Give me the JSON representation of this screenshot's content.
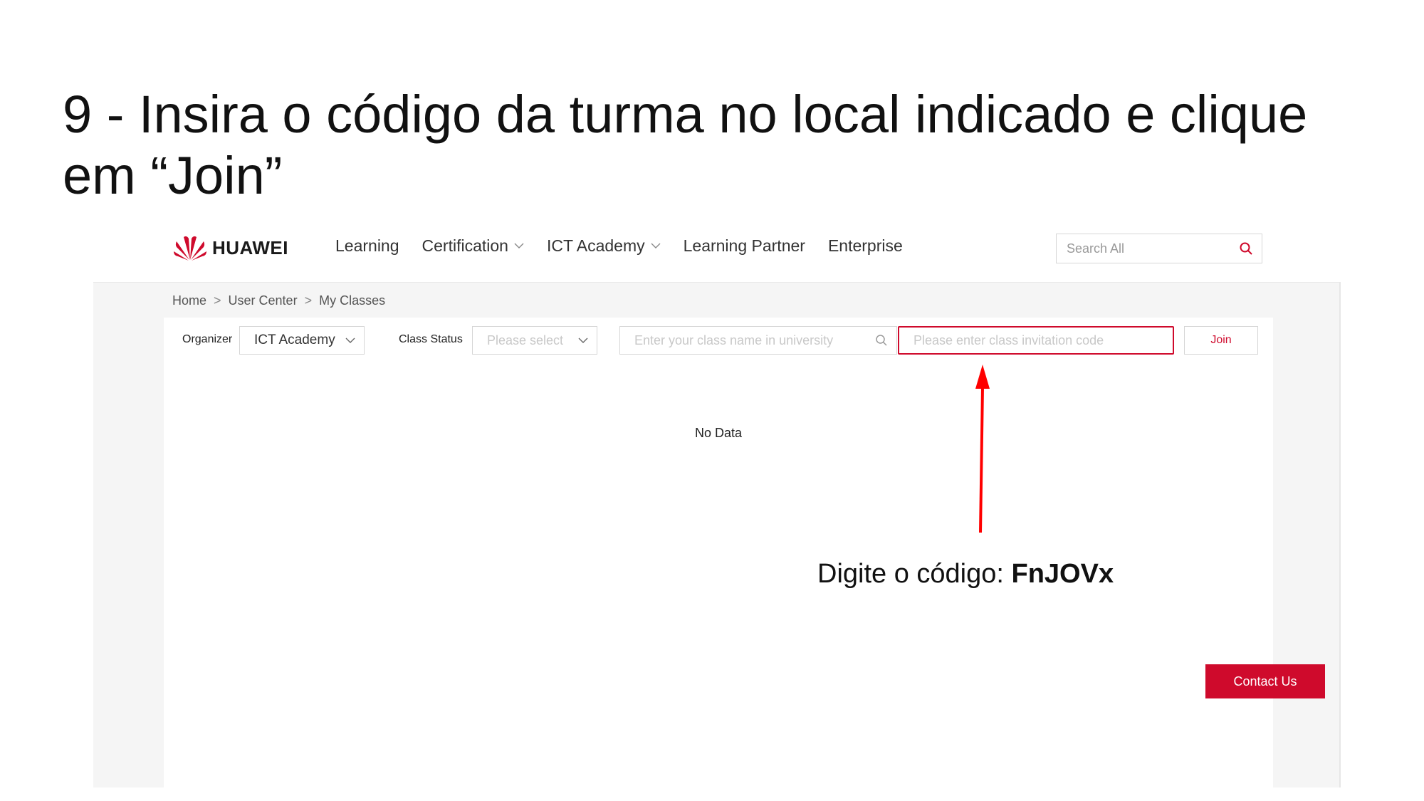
{
  "slide": {
    "title": "9 - Insira o código da turma no local indicado e clique em “Join”",
    "annotation_prefix": "Digite o código: ",
    "annotation_code": "FnJOVx"
  },
  "header": {
    "logo_text": "HUAWEI",
    "nav": [
      {
        "label": "Learning",
        "has_dropdown": false
      },
      {
        "label": "Certification",
        "has_dropdown": true
      },
      {
        "label": "ICT Academy",
        "has_dropdown": true
      },
      {
        "label": "Learning Partner",
        "has_dropdown": false
      },
      {
        "label": "Enterprise",
        "has_dropdown": false
      }
    ],
    "search_placeholder": "Search All"
  },
  "breadcrumb": {
    "items": [
      "Home",
      "User Center",
      "My Classes"
    ],
    "separator": ">"
  },
  "filters": {
    "organizer_label": "Organizer",
    "organizer_value": "ICT Academy",
    "status_label": "Class Status",
    "status_placeholder": "Please select",
    "class_search_placeholder": "Enter your class name in university",
    "code_placeholder": "Please enter class invitation code",
    "join_label": "Join"
  },
  "content": {
    "empty_text": "No Data"
  },
  "contact_label": "Contact Us",
  "colors": {
    "brand_red": "#cf0a2c",
    "arrow_red": "#ff0000",
    "page_gray": "#f5f5f5"
  }
}
